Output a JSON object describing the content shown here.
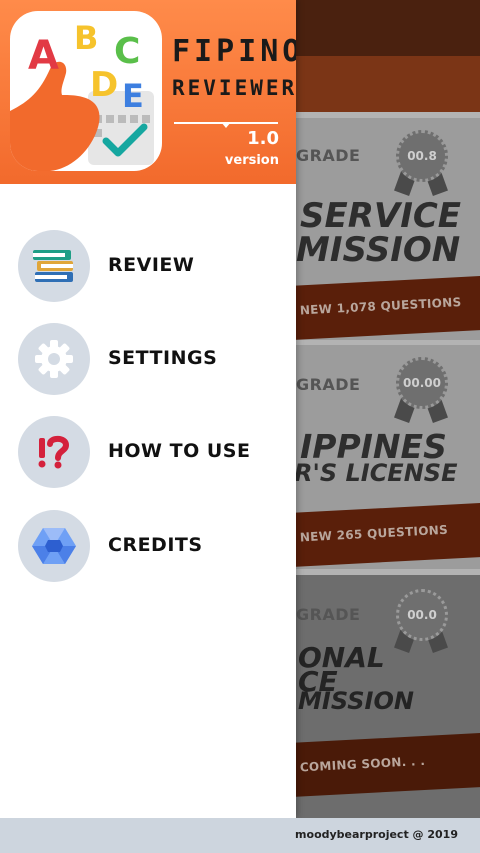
{
  "app": {
    "title_line1": "FIPINO",
    "title_line2": "REVIEWER",
    "version_number": "1.0",
    "version_label": "version",
    "logo_letters": [
      "A",
      "B",
      "C",
      "D",
      "E"
    ]
  },
  "menu": {
    "items": [
      {
        "label": "REVIEW",
        "icon": "books-icon"
      },
      {
        "label": "SETTINGS",
        "icon": "gear-icon"
      },
      {
        "label": "HOW TO USE",
        "icon": "question-exclamation-icon"
      },
      {
        "label": "CREDITS",
        "icon": "hexagon-icon"
      }
    ]
  },
  "background_cards": [
    {
      "grade_label": "EST GRADE",
      "score": "00.8",
      "title_line1": "SERVICE",
      "title_line2": "MISSION",
      "button": "NEW 1,078 QUESTIONS"
    },
    {
      "grade_label": "EST GRADE",
      "score": "00.00",
      "title_line1": "IPPINES",
      "title_line2": "R'S LICENSE",
      "button": "NEW 265 QUESTIONS"
    },
    {
      "grade_label": "EST GRADE",
      "score": "00.0",
      "title_line1": "ONAL",
      "title_line2": "CE",
      "title_line3": "MISSION",
      "button": "COMING SOON. . ."
    }
  ],
  "footer": {
    "text": "moodybearproject @ 2019"
  },
  "colors": {
    "header_orange": "#f26a2c",
    "icon_circle": "#d4dbe4",
    "footer_bg": "#cdd5de"
  }
}
